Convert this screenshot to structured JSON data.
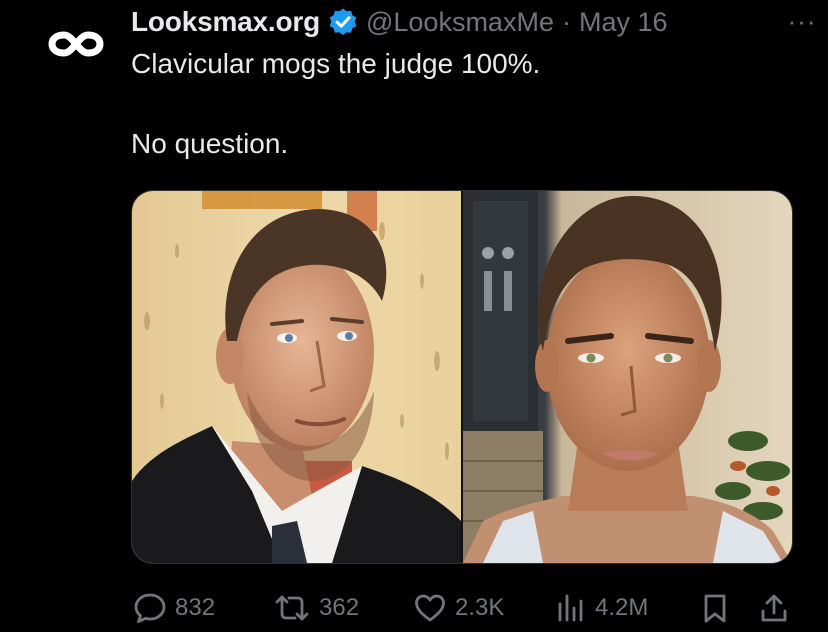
{
  "tweet": {
    "display_name": "Looksmax.org",
    "handle": "@LooksmaxMe",
    "separator": "·",
    "date": "May 16",
    "more_label": "···",
    "text_line1": "Clavicular mogs the judge 100%.",
    "text_line2": "No question.",
    "verified_color": "#1d9bf0",
    "avatar_icon": "infinity-logo-icon"
  },
  "media": {
    "images": [
      {
        "name": "judge-photo",
        "icon": "portrait-photo"
      },
      {
        "name": "young-man-photo",
        "icon": "portrait-photo"
      }
    ]
  },
  "actions": {
    "replies": "832",
    "reposts": "362",
    "likes": "2.3K",
    "views": "4.2M",
    "icons": [
      "reply-icon",
      "repost-icon",
      "like-icon",
      "views-icon",
      "bookmark-icon",
      "share-icon"
    ]
  }
}
